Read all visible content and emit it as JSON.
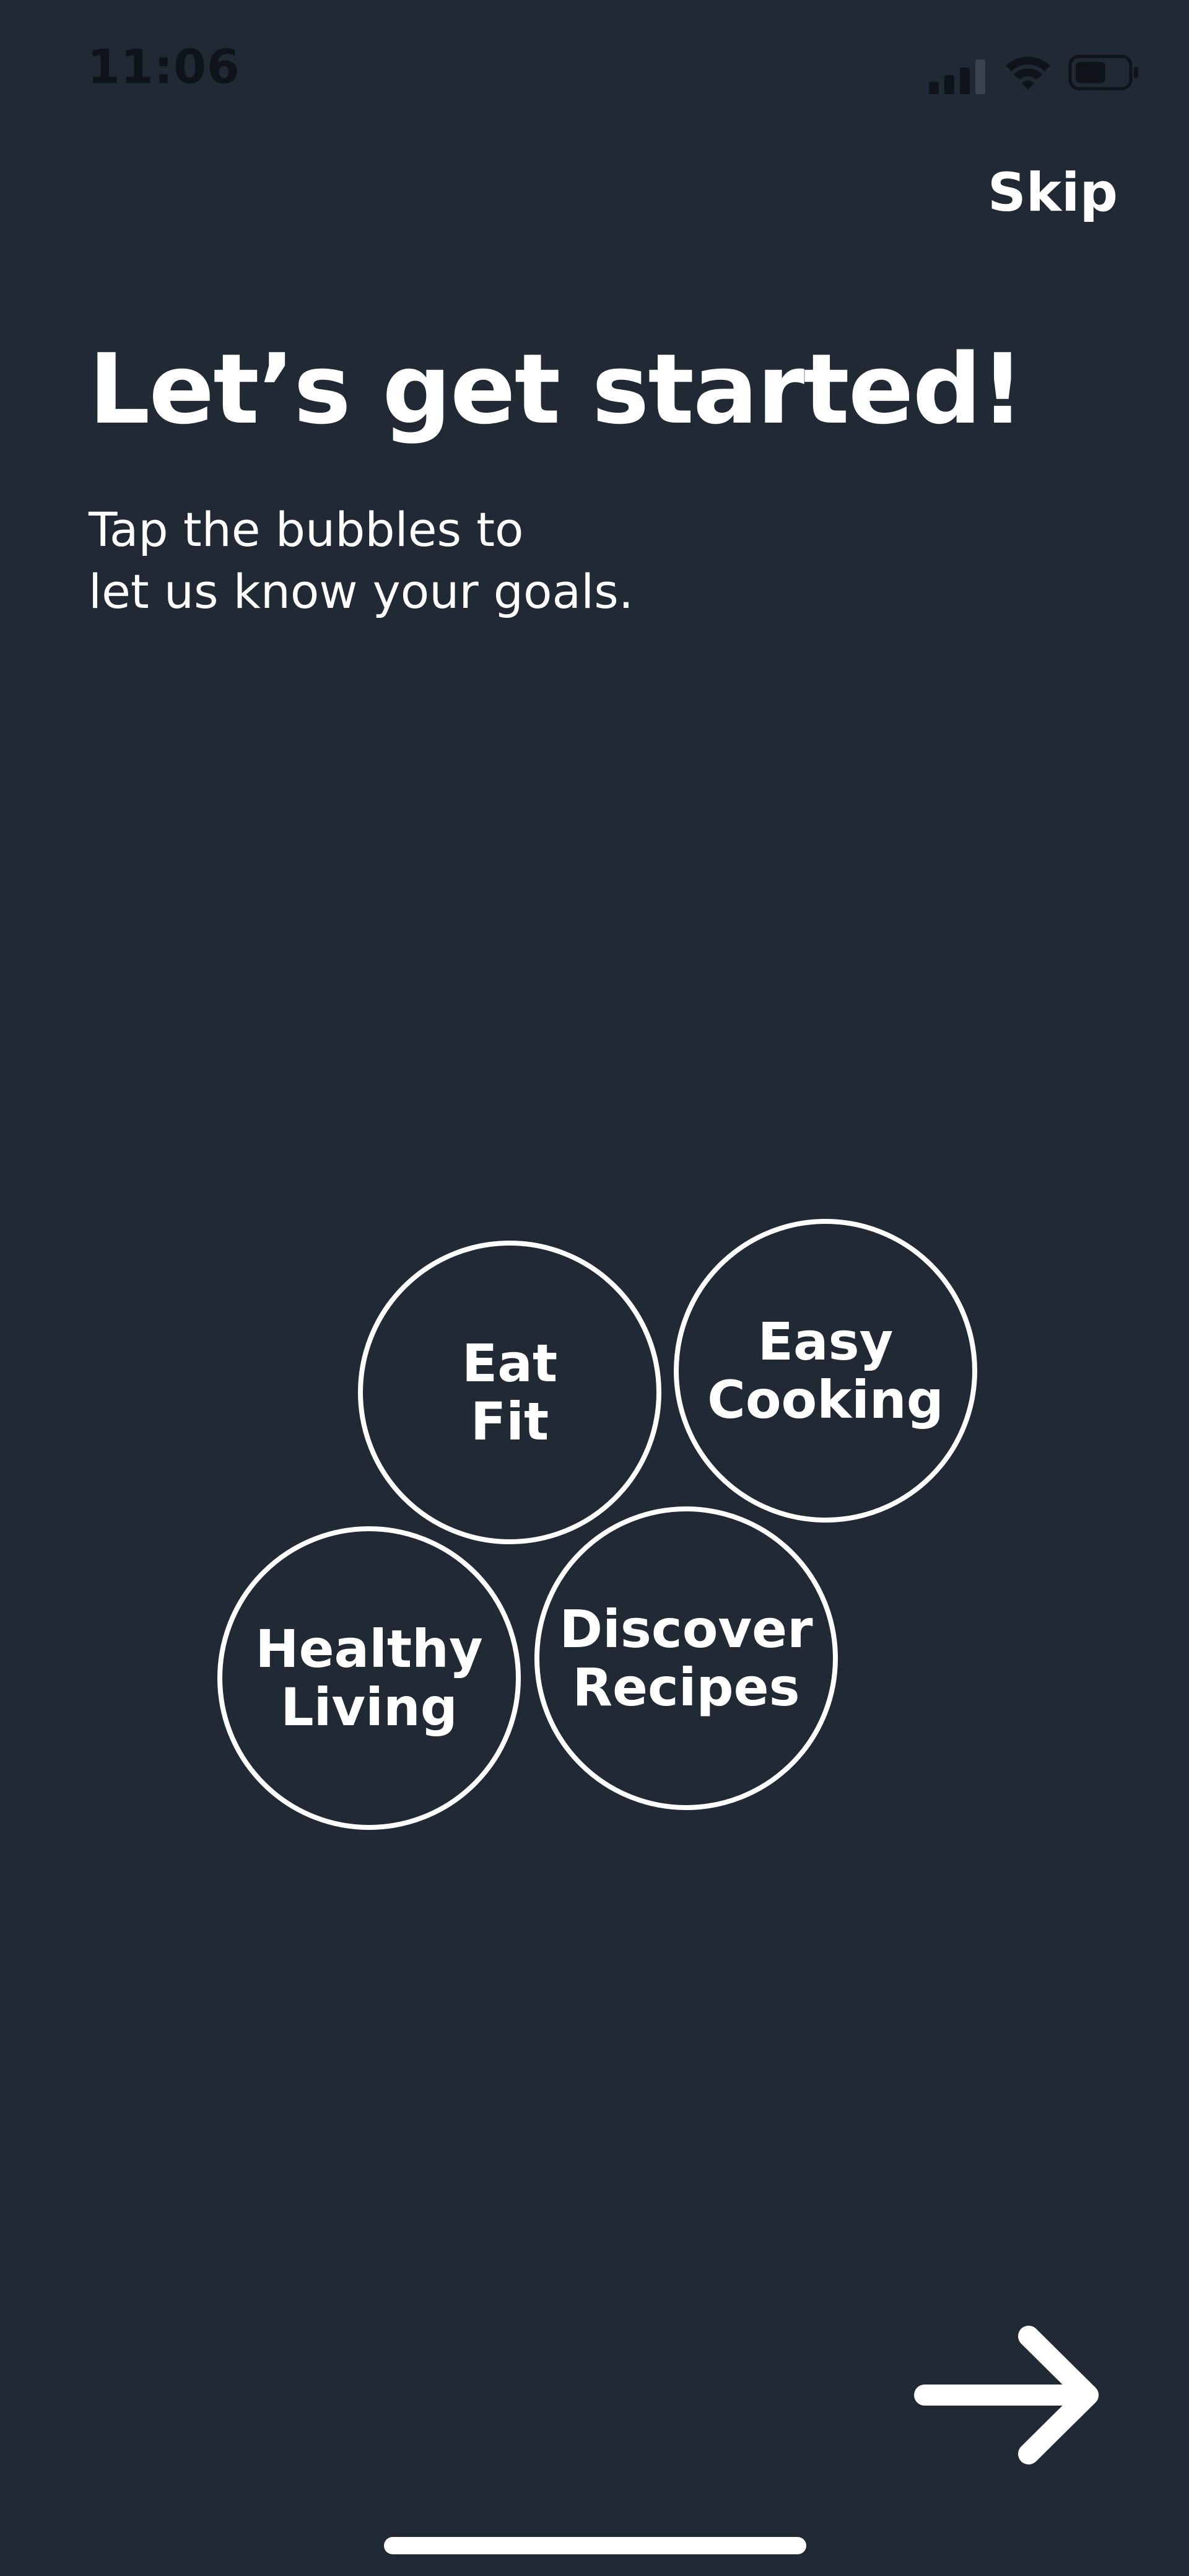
{
  "status_bar": {
    "time": "11:06"
  },
  "header": {
    "skip_label": "Skip"
  },
  "intro": {
    "title": "Let’s get started!",
    "subtitle_line1": "Tap the bubbles to",
    "subtitle_line2": "let us know your goals."
  },
  "bubbles": [
    {
      "line1": "Eat",
      "line2": "Fit"
    },
    {
      "line1": "Easy",
      "line2": "Cooking"
    },
    {
      "line1": "Healthy",
      "line2": "Living"
    },
    {
      "line1": "Discover",
      "line2": "Recipes"
    }
  ],
  "icons": {
    "signal": "signal-icon",
    "wifi": "wifi-icon",
    "battery": "battery-icon",
    "next": "arrow-right-icon"
  },
  "colors": {
    "background": "#212934",
    "foreground": "#ffffff",
    "status_text": "#0f141a"
  }
}
